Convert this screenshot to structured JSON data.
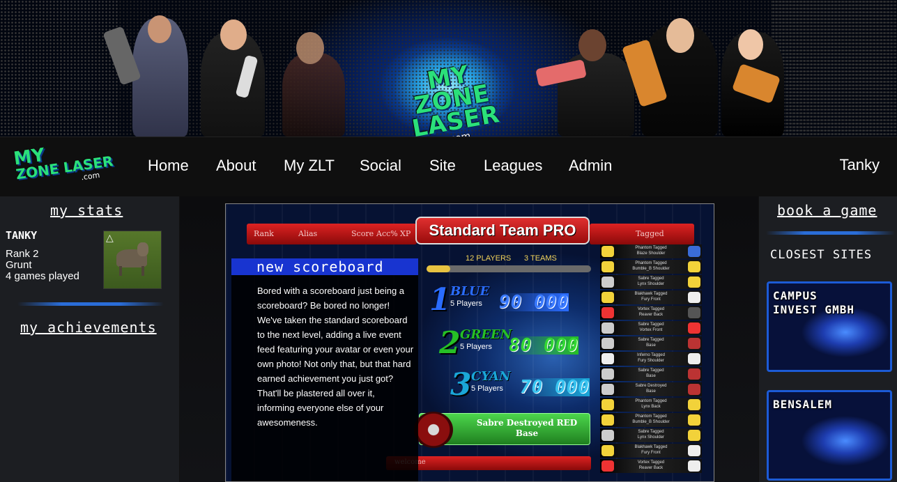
{
  "banner": {
    "logo_line1": "MY",
    "logo_line2": "ZONE LASER",
    "logo_com": ".com"
  },
  "navbar": {
    "logo_line1": "MY",
    "logo_line2": "ZONE LASER",
    "logo_com": ".com",
    "items": [
      "Home",
      "About",
      "My ZLT",
      "Social",
      "Site",
      "Leagues",
      "Admin"
    ],
    "user": "Tanky"
  },
  "left": {
    "stats_title": "my stats",
    "username": "TANKY",
    "rank": "Rank 2",
    "rank_title": "Grunt",
    "games": "4 games played",
    "achievements_title": "my achievements"
  },
  "right": {
    "book_title": "book a game",
    "closest_title": "CLOSEST SITES",
    "sites": [
      "CAMPUS INVEST GMBH",
      "BENSALEM"
    ]
  },
  "scoreboard": {
    "header_cols": [
      "Rank",
      "Alias",
      "Score",
      "Acc%",
      "XP"
    ],
    "tagged_label": "Tagged",
    "title": "Standard Team PRO",
    "players_info": "12 PLAYERS",
    "teams_info": "3 TEAMS",
    "teams": [
      {
        "num": "1",
        "name": "BLUE",
        "players": "5 Players",
        "score": "90 000",
        "color": "#2a6cff"
      },
      {
        "num": "2",
        "name": "GREEN",
        "players": "5 Players",
        "score": "80 000",
        "color": "#26c026"
      },
      {
        "num": "3",
        "name": "CYAN",
        "players": "5 Players",
        "score": "70 000",
        "color": "#1aa6d8"
      }
    ],
    "event": "Sabre Destroyed RED Base",
    "welcome": "welcome",
    "news_title": "new scoreboard",
    "news_body": "Bored with a scoreboard just being a scoreboard? Be bored no longer! We've taken the standard scoreboard to the next level, adding a live event feed featuring your avatar or even your own photo! Not only that, but that hard earned achievement you just got? That'll be plastered all over it, informing everyone else of your awesomeness.",
    "feed": [
      {
        "line1": "Phantom Tagged",
        "line2": "Blaze Shoulder"
      },
      {
        "line1": "Phantom Tagged",
        "line2": "Bumble_B Shoulder"
      },
      {
        "line1": "Sabre Tagged",
        "line2": "Lynx Shoulder"
      },
      {
        "line1": "Blakhawk Tagged",
        "line2": "Fury Front"
      },
      {
        "line1": "Vortex Tagged",
        "line2": "Reaver Back"
      },
      {
        "line1": "Sabre Tagged",
        "line2": "Vortex Front"
      },
      {
        "line1": "Sabre Tagged",
        "line2": "Base"
      },
      {
        "line1": "Inferno Tagged",
        "line2": "Fury Shoulder"
      },
      {
        "line1": "Sabre Tagged",
        "line2": "Base"
      },
      {
        "line1": "Sabre Destroyed",
        "line2": "Base"
      },
      {
        "line1": "Phantom Tagged",
        "line2": "Lynx Back"
      },
      {
        "line1": "Phantom Tagged",
        "line2": "Bumble_B Shoulder"
      },
      {
        "line1": "Sabre Tagged",
        "line2": "Lynx Shoulder"
      },
      {
        "line1": "Blakhawk Tagged",
        "line2": "Fury Front"
      },
      {
        "line1": "Vortex Tagged",
        "line2": "Reaver Back"
      }
    ]
  }
}
